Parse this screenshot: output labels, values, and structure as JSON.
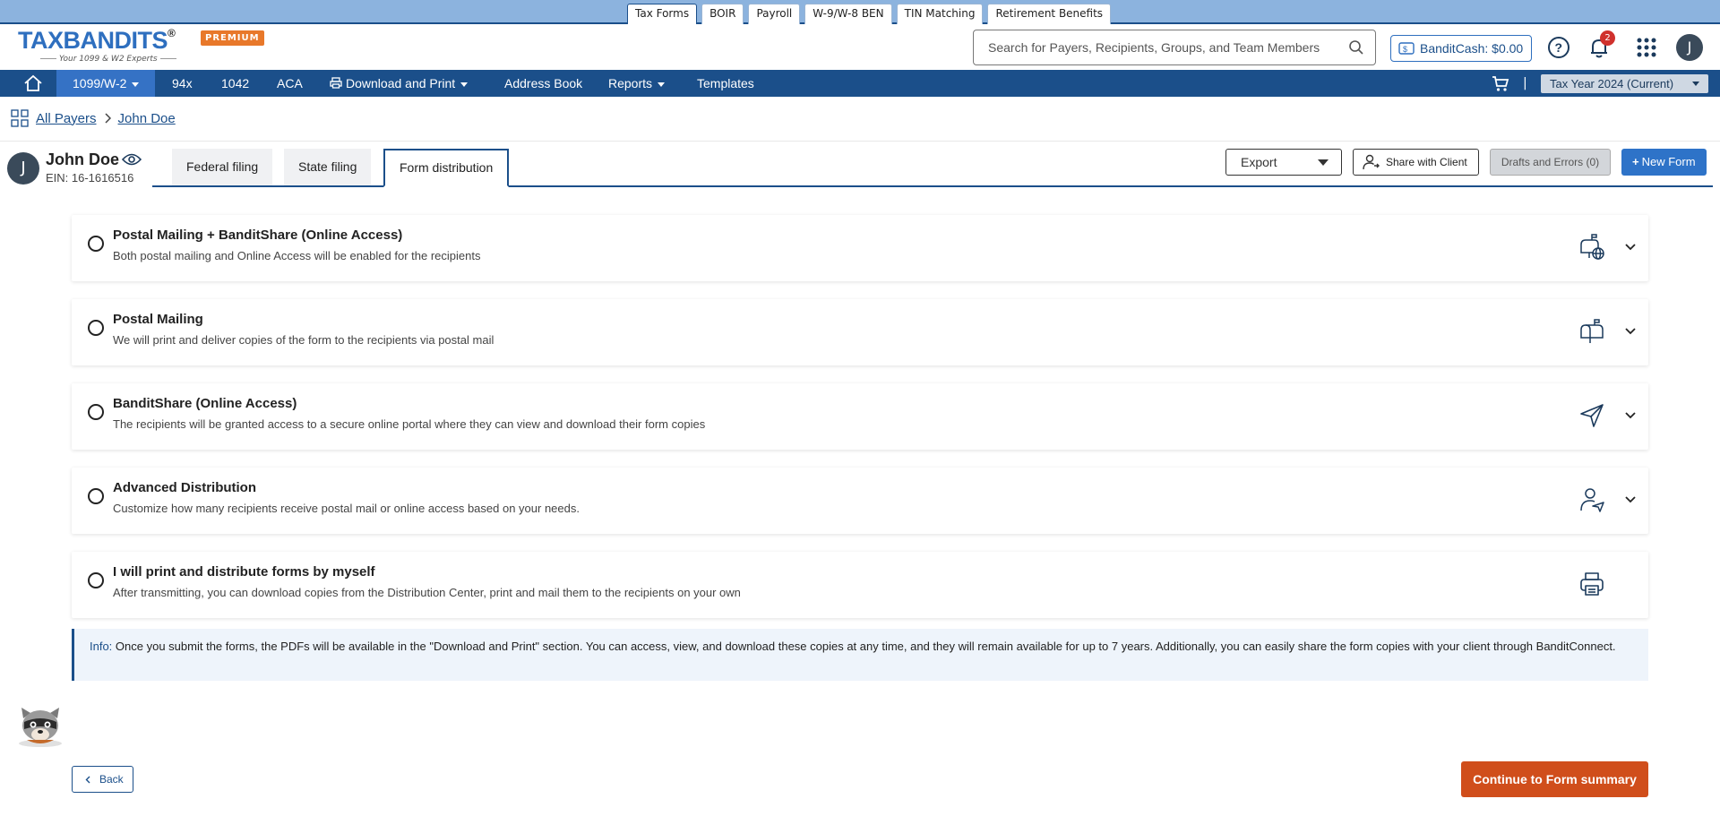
{
  "product_tabs": [
    "Tax Forms",
    "BOIR",
    "Payroll",
    "W-9/W-8 BEN",
    "TIN Matching",
    "Retirement Benefits"
  ],
  "logo": {
    "brand": "TAXBANDITS",
    "tagline": "Your 1099 & W2 Experts",
    "badge": "PREMIUM"
  },
  "search": {
    "placeholder": "Search for Payers, Recipients, Groups, and Team Members"
  },
  "header": {
    "banditcash": "BanditCash: $0.00",
    "notifications_count": "2",
    "user_initial": "J"
  },
  "nav": {
    "items": [
      "1099/W-2",
      "94x",
      "1042",
      "ACA",
      "Download and Print",
      "Address Book",
      "Reports",
      "Templates"
    ],
    "tax_year": "Tax Year 2024 (Current)",
    "separator": "|"
  },
  "breadcrumb": {
    "root": "All Payers",
    "current": "John Doe"
  },
  "payer": {
    "initial": "J",
    "name": "John Doe",
    "ein": "EIN: 16-1616516"
  },
  "filing_tabs": [
    "Federal filing",
    "State filing",
    "Form distribution"
  ],
  "actions": {
    "export": "Export",
    "share": "Share with Client",
    "drafts": "Drafts and Errors (0)",
    "new_form": "New Form"
  },
  "options": [
    {
      "title": "Postal Mailing + BanditShare (Online Access)",
      "desc": "Both postal mailing and Online Access will be enabled for the recipients",
      "icon": "mailbox-globe-icon"
    },
    {
      "title": "Postal Mailing",
      "desc": "We will print and deliver copies of the form to the recipients via postal mail",
      "icon": "mailbox-icon"
    },
    {
      "title": "BanditShare (Online Access)",
      "desc": "The recipients will be granted access to a secure online portal where they can view and download their form copies",
      "icon": "paper-plane-icon"
    },
    {
      "title": "Advanced Distribution",
      "desc": "Customize how many recipients receive postal mail or online access based on your needs.",
      "icon": "user-send-icon"
    },
    {
      "title": "I will print and distribute forms by myself",
      "desc": "After transmitting, you can download copies from the Distribution Center, print and mail them to the recipients on your own",
      "icon": "printer-icon"
    }
  ],
  "info": {
    "label": "Info:",
    "text": "Once you submit the forms, the PDFs will be available in the \"Download and Print\" section. You can access, view, and download these copies at any time, and they will remain available for up to 7 years. Additionally, you can easily share the form copies with your client through BanditConnect."
  },
  "footer": {
    "back": "Back",
    "continue": "Continue to Form summary"
  },
  "colors": {
    "navy": "#1b4f8a",
    "accent_blue": "#2e73c8",
    "cta_orange": "#d04e1b",
    "premium_orange": "#e8782a",
    "strip": "#8cb3de"
  }
}
